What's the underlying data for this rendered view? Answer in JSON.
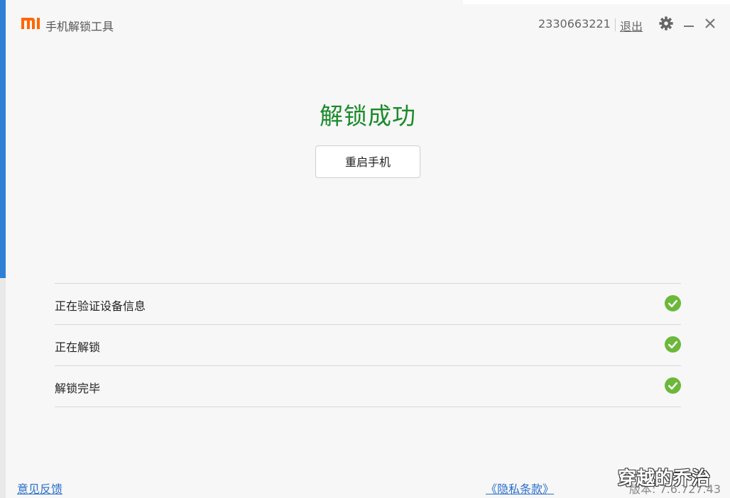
{
  "app": {
    "brand_color": "#ff6700",
    "title": "手机解锁工具",
    "account_id": "2330663221",
    "logout_label": "退出"
  },
  "window_controls": {
    "settings_icon": "gear-icon",
    "minimize_icon": "minimize-icon",
    "close_icon": "close-icon"
  },
  "main": {
    "status_title": "解锁成功",
    "status_color": "#1a8a2a",
    "restart_button_label": "重启手机"
  },
  "steps": [
    {
      "label": "正在验证设备信息",
      "status": "done",
      "icon": "check-circle-icon"
    },
    {
      "label": "正在解锁",
      "status": "done",
      "icon": "check-circle-icon"
    },
    {
      "label": "解锁完毕",
      "status": "done",
      "icon": "check-circle-icon"
    }
  ],
  "footer": {
    "feedback_link": "意见反馈",
    "privacy_link": "《隐私条款》",
    "version": "版本: 7.6.727.43"
  },
  "watermark": "穿越的乔治"
}
